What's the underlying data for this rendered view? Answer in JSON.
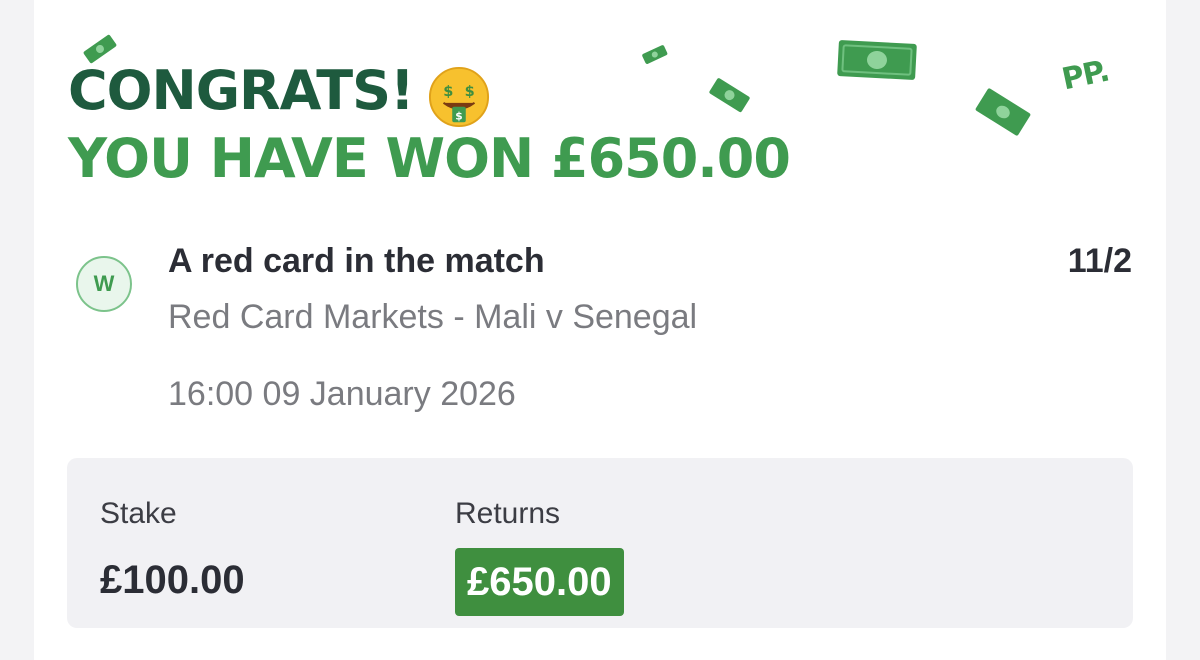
{
  "banner": {
    "headline": "CONGRATS!",
    "subheadline": "YOU HAVE WON £650.00",
    "emoji_icon": "money-mouth-face-icon",
    "logo_text": "PP.",
    "decoration_icon": "banknote-icon"
  },
  "selection": {
    "status_letter": "W",
    "name": "A red card in the match",
    "odds": "11/2",
    "market": "Red Card Markets - Mali v Senegal",
    "datetime": "16:00 09 January 2026"
  },
  "summary": {
    "stake_label": "Stake",
    "stake_value": "£100.00",
    "returns_label": "Returns",
    "returns_value": "£650.00"
  },
  "colors": {
    "dark_green": "#1e5a3e",
    "brand_green": "#3f9b50",
    "returns_green": "#3f8f3f",
    "text_dark": "#2b2d35",
    "text_muted": "#7a7b80",
    "panel_bg": "#f1f1f4"
  }
}
